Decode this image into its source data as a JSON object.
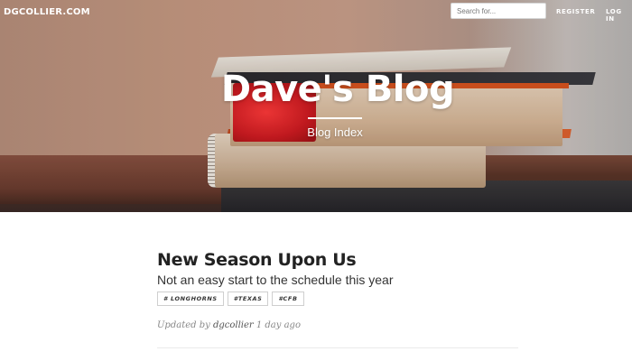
{
  "nav": {
    "brand": "DGCOLLIER.COM",
    "search_placeholder": "Search for...",
    "register_label": "REGISTER",
    "login_label": "LOG IN"
  },
  "hero": {
    "title": "Dave's Blog",
    "subtitle": "Blog Index"
  },
  "post": {
    "title": "New Season Upon Us",
    "subtitle": "Not an easy start to the schedule this year",
    "tags": [
      "# LONGHORNS",
      "#TEXAS",
      "#CFB"
    ],
    "meta_prefix": "Updated by",
    "author": "dgcollier",
    "updated": "1 day ago"
  },
  "colors": {
    "hero_text": "#ffffff",
    "post_title": "#222222",
    "meta": "#888888"
  }
}
